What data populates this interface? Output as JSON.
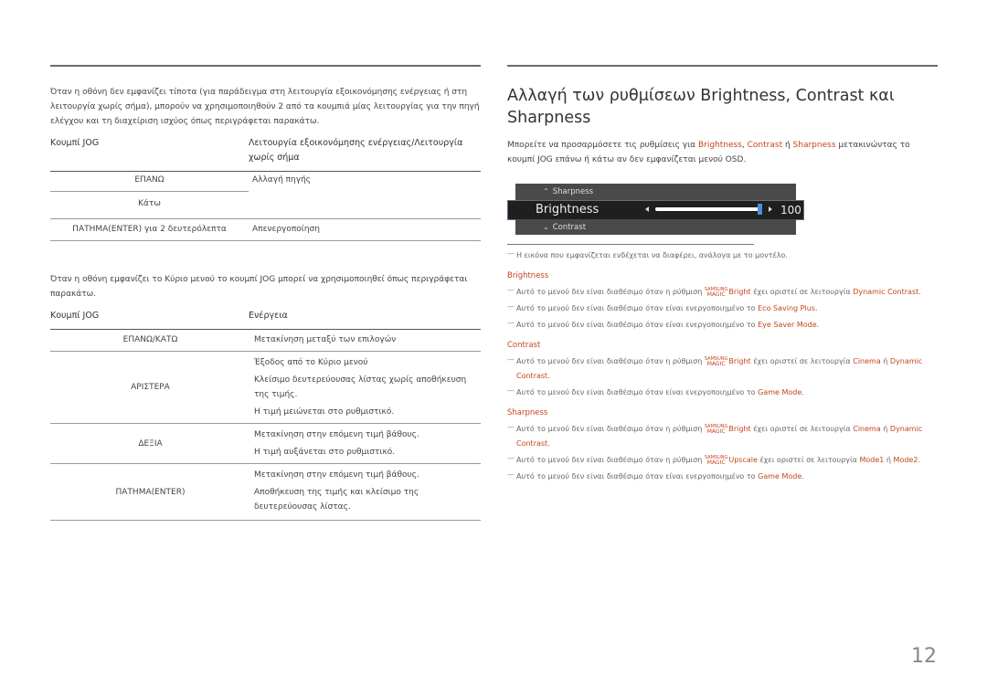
{
  "left": {
    "intro1": "Όταν η οθόνη δεν εμφανίζει τίποτα (για παράδειγμα στη λειτουργία εξοικονόμησης ενέργειας ή στη λειτουργία χωρίς σήμα), μπορούν να χρησιμοποιηθούν 2 από τα κουμπιά μίας λειτουργίας για την πηγή ελέγχου και τη διαχείριση ισχύος όπως περιγράφεται παρακάτω.",
    "table1": {
      "headers": [
        "Κουμπί JOG",
        "Λειτουργία εξοικονόμησης ενέργειας/Λειτουργία χωρίς σήμα"
      ],
      "rows": [
        {
          "key": "ΕΠΑΝΩ",
          "value": "Αλλαγή πηγής"
        },
        {
          "key": "Κάτω",
          "value": ""
        },
        {
          "key": "ΠΑΤΗΜΑ(ENTER) για 2 δευτερόλεπτα",
          "value": "Απενεργοποίηση"
        }
      ]
    },
    "intro2": "Όταν η οθόνη εμφανίζει το Κύριο μενού το κουμπί JOG μπορεί να χρησιμοποιηθεί όπως περιγράφεται παρακάτω.",
    "table2": {
      "headers": [
        "Κουμπί JOG",
        "Ενέργεια"
      ],
      "rows": [
        {
          "key": "ΕΠΑΝΩ/ΚΑΤΩ",
          "values": [
            "Μετακίνηση μεταξύ των επιλογών"
          ]
        },
        {
          "key": "ΑΡΙΣΤΕΡΑ",
          "values": [
            "Έξοδος από το Κύριο μενού",
            "Κλείσιμο δευτερεύουσας λίστας χωρίς αποθήκευση της τιμής.",
            "Η τιμή μειώνεται στο ρυθμιστικό."
          ]
        },
        {
          "key": "ΔΕΞΙΑ",
          "values": [
            "Μετακίνηση στην επόμενη τιμή βάθους.",
            "Η τιμή αυξάνεται στο ρυθμιστικό."
          ]
        },
        {
          "key": "ΠΑΤΗΜΑ(ENTER)",
          "values": [
            "Μετακίνηση στην επόμενη τιμή βάθους.",
            "Αποθήκευση της τιμής και κλείσιμο της δευτερεύουσας λίστας."
          ]
        }
      ]
    }
  },
  "right": {
    "title": "Αλλαγή των ρυθμίσεων Brightness, Contrast και Sharpness",
    "desc": {
      "pre": "Μπορείτε να προσαρμόσετε τις ρυθμίσεις για ",
      "b": "Brightness",
      "comma": ", ",
      "c": "Contrast",
      "or": " ή ",
      "s": "Sharpness",
      "post": " μετακινώντας το κουμπί JOG επάνω ή κάτω αν δεν εμφανίζεται μενού OSD."
    },
    "osd": {
      "top_label": "Sharpness",
      "main_label": "Brightness",
      "value": "100",
      "slider_fraction": 1.0,
      "bottom_label": "Contrast"
    },
    "image_note": "Η εικόνα που εμφανίζεται ενδέχεται να διαφέρει, ανάλογα με το μοντέλο.",
    "magic_top": "SAMSUNG",
    "magic_bottom": "MAGIC",
    "sections": [
      {
        "heading": "Brightness",
        "notes": [
          {
            "parts": [
              {
                "t": "Αυτό το μενού δεν είναι διαθέσιμο όταν η ρύθμιση "
              },
              {
                "magic": "Bright"
              },
              {
                "t": " έχει οριστεί σε λειτουργία "
              },
              {
                "a": "Dynamic Contrast"
              },
              {
                "t": "."
              }
            ]
          },
          {
            "parts": [
              {
                "t": "Αυτό το μενού δεν είναι διαθέσιμο όταν είναι ενεργοποιημένο το "
              },
              {
                "a": "Eco Saving Plus"
              },
              {
                "t": "."
              }
            ]
          },
          {
            "parts": [
              {
                "t": "Αυτό το μενού δεν είναι διαθέσιμο όταν είναι ενεργοποιημένο το "
              },
              {
                "a": "Eye Saver Mode"
              },
              {
                "t": "."
              }
            ]
          }
        ]
      },
      {
        "heading": "Contrast",
        "notes": [
          {
            "parts": [
              {
                "t": "Αυτό το μενού δεν είναι διαθέσιμο όταν η ρύθμιση "
              },
              {
                "magic": "Bright"
              },
              {
                "t": " έχει οριστεί σε λειτουργία "
              },
              {
                "a": "Cinema"
              },
              {
                "t": " ή "
              },
              {
                "a": "Dynamic Contrast"
              },
              {
                "t": "."
              }
            ]
          },
          {
            "parts": [
              {
                "t": "Αυτό το μενού δεν είναι διαθέσιμο όταν είναι ενεργοποιημένο το "
              },
              {
                "a": "Game Mode"
              },
              {
                "t": "."
              }
            ]
          }
        ]
      },
      {
        "heading": "Sharpness",
        "notes": [
          {
            "parts": [
              {
                "t": "Αυτό το μενού δεν είναι διαθέσιμο όταν η ρύθμιση "
              },
              {
                "magic": "Bright"
              },
              {
                "t": " έχει οριστεί σε λειτουργία "
              },
              {
                "a": "Cinema"
              },
              {
                "t": " ή "
              },
              {
                "a": "Dynamic Contrast"
              },
              {
                "t": "."
              }
            ]
          },
          {
            "parts": [
              {
                "t": "Αυτό το μενού δεν είναι διαθέσιμο όταν η ρύθμιση "
              },
              {
                "magic": "Upscale"
              },
              {
                "t": " έχει οριστεί σε λειτουργία "
              },
              {
                "a": "Mode1"
              },
              {
                "t": " ή "
              },
              {
                "a": "Mode2"
              },
              {
                "t": "."
              }
            ]
          },
          {
            "parts": [
              {
                "t": "Αυτό το μενού δεν είναι διαθέσιμο όταν είναι ενεργοποιημένο το "
              },
              {
                "a": "Game Mode"
              },
              {
                "t": "."
              }
            ]
          }
        ]
      }
    ]
  },
  "page_number": "12",
  "colors": {
    "accent": "#c4451c",
    "slider_thumb": "#4a8fd8"
  }
}
